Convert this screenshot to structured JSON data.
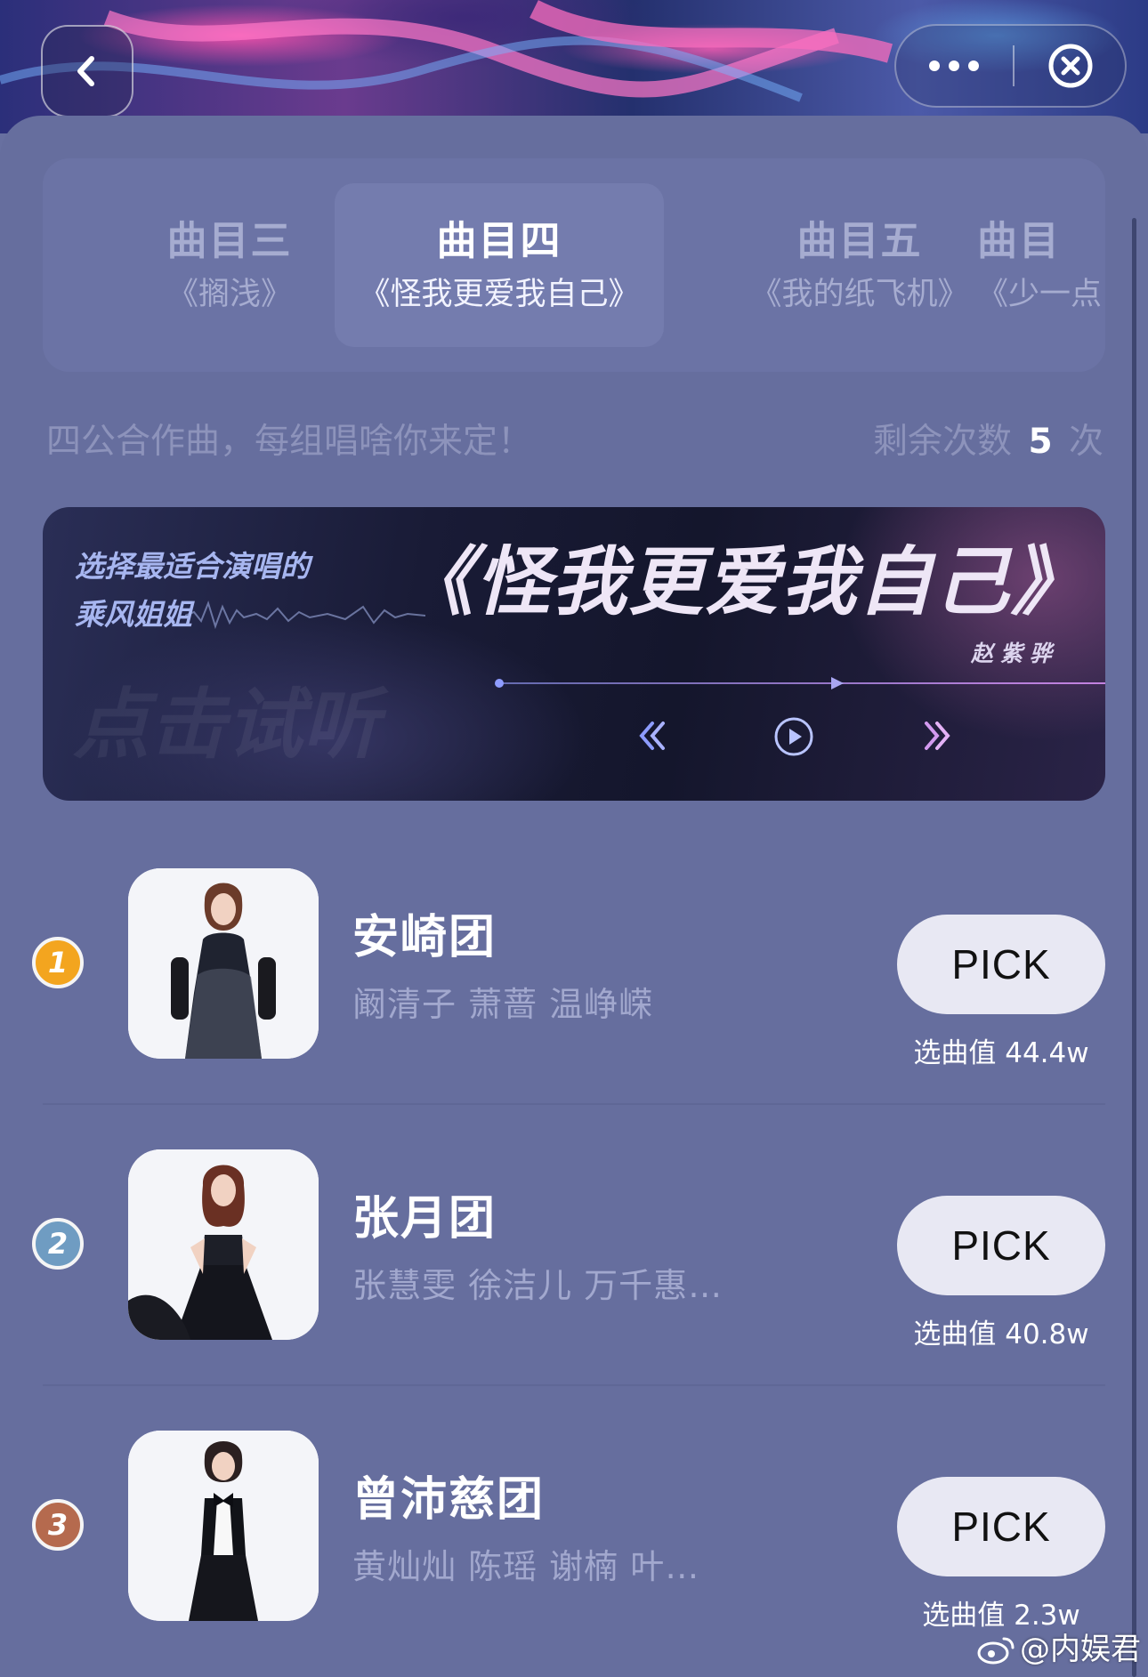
{
  "header": {
    "back_icon": "chevron-left-icon",
    "more_icon": "more-dots-icon",
    "close_icon": "close-circle-icon"
  },
  "tabs": [
    {
      "title": "曲目三",
      "subtitle": "《搁浅》",
      "active": false
    },
    {
      "title": "曲目四",
      "subtitle": "《怪我更爱我自己》",
      "active": true
    },
    {
      "title": "曲目五",
      "subtitle": "《我的纸飞机》",
      "active": false
    },
    {
      "title": "曲目",
      "subtitle": "《少一点",
      "active": false
    }
  ],
  "info": {
    "description": "四公合作曲，每组唱啥你来定！",
    "remaining_prefix": "剩余次数",
    "remaining_count": "5",
    "remaining_suffix": "次"
  },
  "song_banner": {
    "prompt_line1": "选择最适合演唱的",
    "prompt_line2": "乘风姐姐",
    "watermark": "点击试听",
    "song_title": "《怪我更爱我自己》",
    "artist": "赵紫骅",
    "accent_color": "#e3a9ec"
  },
  "ranking": [
    {
      "rank": "1",
      "badge_color": "#f3a51f",
      "group": "安崎团",
      "members": "阚清子 萧蔷 温峥嵘",
      "button": "PICK",
      "score_label": "选曲值",
      "score": "44.4w"
    },
    {
      "rank": "2",
      "badge_color": "#6f9cc2",
      "group": "张月团",
      "members": "张慧雯 徐洁儿 万千惠…",
      "button": "PICK",
      "score_label": "选曲值",
      "score": "40.8w"
    },
    {
      "rank": "3",
      "badge_color": "#b56a4e",
      "group": "曾沛慈团",
      "members": "黄灿灿 陈瑶 谢楠 叶…",
      "button": "PICK",
      "score_label": "选曲值",
      "score": "2.3w"
    }
  ],
  "watermark": {
    "icon": "weibo-icon",
    "text": "@内娱君"
  }
}
